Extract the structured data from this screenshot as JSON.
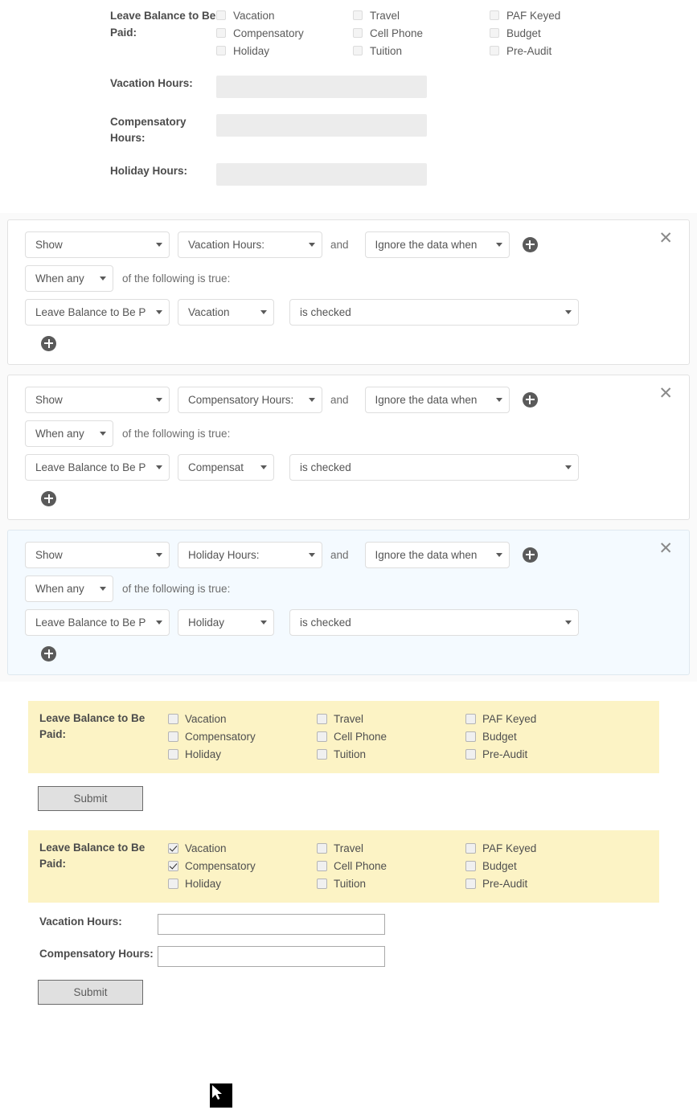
{
  "top_form": {
    "leave_label": "Leave Balance to Be Paid:",
    "checkbox_columns": [
      [
        "Vacation",
        "Compensatory",
        "Holiday"
      ],
      [
        "Travel",
        "Cell Phone",
        "Tuition"
      ],
      [
        "PAF Keyed",
        "Budget",
        "Pre-Audit"
      ]
    ],
    "hours_fields": [
      {
        "label": "Vacation Hours:",
        "value": ""
      },
      {
        "label": "Compensatory Hours:",
        "value": ""
      },
      {
        "label": "Holiday Hours:",
        "value": ""
      }
    ]
  },
  "rules": [
    {
      "action": "Show",
      "target_field": "Vacation Hours:",
      "and_word": "and",
      "behavior": "Ignore the data when",
      "match": "When any",
      "match_suffix": "of the following is true:",
      "source_field": "Leave Balance to Be P",
      "source_option": "Vacation",
      "condition": "is checked",
      "close_label": "✕",
      "highlighted": false
    },
    {
      "action": "Show",
      "target_field": "Compensatory Hours:",
      "and_word": "and",
      "behavior": "Ignore the data when",
      "match": "When any",
      "match_suffix": "of the following is true:",
      "source_field": "Leave Balance to Be P",
      "source_option": "Compensat",
      "condition": "is checked",
      "close_label": "✕",
      "highlighted": false
    },
    {
      "action": "Show",
      "target_field": "Holiday Hours:",
      "and_word": "and",
      "behavior": "Ignore the data when",
      "match": "When any",
      "match_suffix": "of the following is true:",
      "source_field": "Leave Balance to Be P",
      "source_option": "Holiday",
      "condition": "is checked",
      "close_label": "✕",
      "highlighted": true
    }
  ],
  "preview_one": {
    "leave_label": "Leave Balance to Be Paid:",
    "columns": [
      [
        {
          "label": "Vacation",
          "checked": false
        },
        {
          "label": "Compensatory",
          "checked": false
        },
        {
          "label": "Holiday",
          "checked": false
        }
      ],
      [
        {
          "label": "Travel",
          "checked": false
        },
        {
          "label": "Cell Phone",
          "checked": false
        },
        {
          "label": "Tuition",
          "checked": false
        }
      ],
      [
        {
          "label": "PAF Keyed",
          "checked": false
        },
        {
          "label": "Budget",
          "checked": false
        },
        {
          "label": "Pre-Audit",
          "checked": false
        }
      ]
    ],
    "submit_label": "Submit"
  },
  "preview_two": {
    "leave_label": "Leave Balance to Be Paid:",
    "columns": [
      [
        {
          "label": "Vacation",
          "checked": true
        },
        {
          "label": "Compensatory",
          "checked": true
        },
        {
          "label": "Holiday",
          "checked": false
        }
      ],
      [
        {
          "label": "Travel",
          "checked": false
        },
        {
          "label": "Cell Phone",
          "checked": false
        },
        {
          "label": "Tuition",
          "checked": false
        }
      ],
      [
        {
          "label": "PAF Keyed",
          "checked": false
        },
        {
          "label": "Budget",
          "checked": false
        },
        {
          "label": "Pre-Audit",
          "checked": false
        }
      ]
    ],
    "live_fields": [
      {
        "label": "Vacation Hours:",
        "value": "",
        "placeholder": ""
      },
      {
        "label": "Compensatory Hours:",
        "value": "",
        "placeholder": ""
      }
    ],
    "submit_label": "Submit"
  },
  "colors": {
    "highlight_block": "#f4faff",
    "preview_yellow": "#fcf3c5",
    "disabled_input": "#ececec",
    "plus_circle": "#5a5a5a"
  }
}
